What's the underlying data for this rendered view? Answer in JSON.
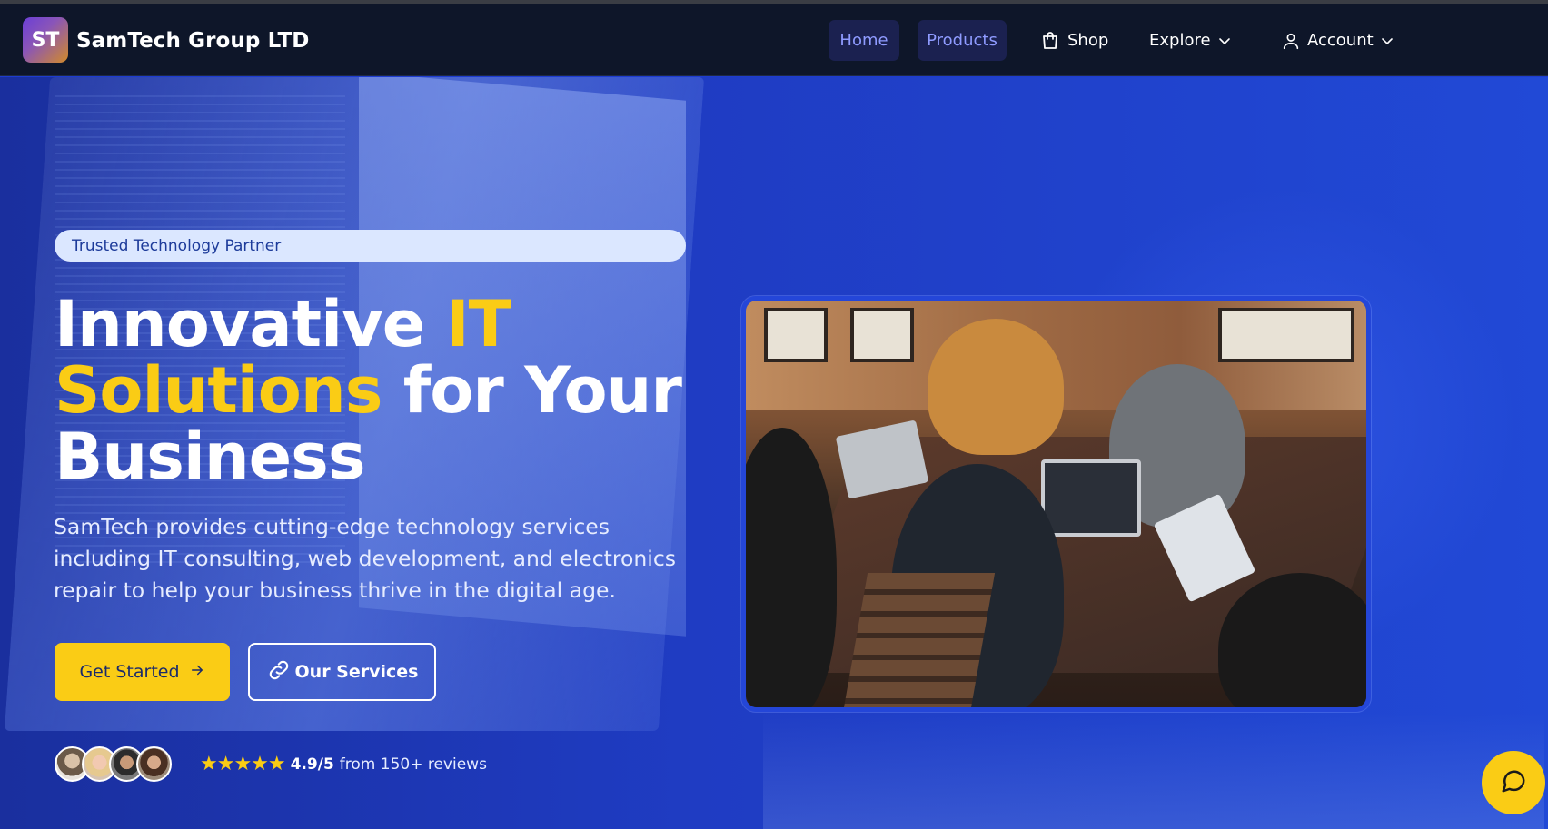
{
  "brand": {
    "logo_initials": "ST",
    "name": "SamTech Group LTD"
  },
  "nav": {
    "home": "Home",
    "products": "Products",
    "shop": "Shop",
    "explore": "Explore",
    "account": "Account",
    "active_color": "#8f9bff",
    "active_bg": "#1b2150"
  },
  "hero": {
    "tagline": "Trusted Technology Partner",
    "headline_part1": "Innovative ",
    "headline_accent1": "IT",
    "headline_accent2": "Solutions",
    "headline_part2": " for Your",
    "headline_part3": "Business",
    "description": "SamTech provides cutting-edge technology services including IT consulting, web development, and electronics repair to help your business thrive in the digital age.",
    "primary_button": "Get Started",
    "secondary_button": "Our Services",
    "rating_value": "4.9/5",
    "rating_text": "from 150+ reviews",
    "stars": "★★★★★",
    "accent_color": "#facc15"
  },
  "icons": {
    "shop": "shopping-bag-icon",
    "explore_chevron": "chevron-down-icon",
    "account": "user-icon",
    "arrow": "arrow-right-icon",
    "link": "link-icon",
    "chat": "chat-bubble-icon"
  }
}
